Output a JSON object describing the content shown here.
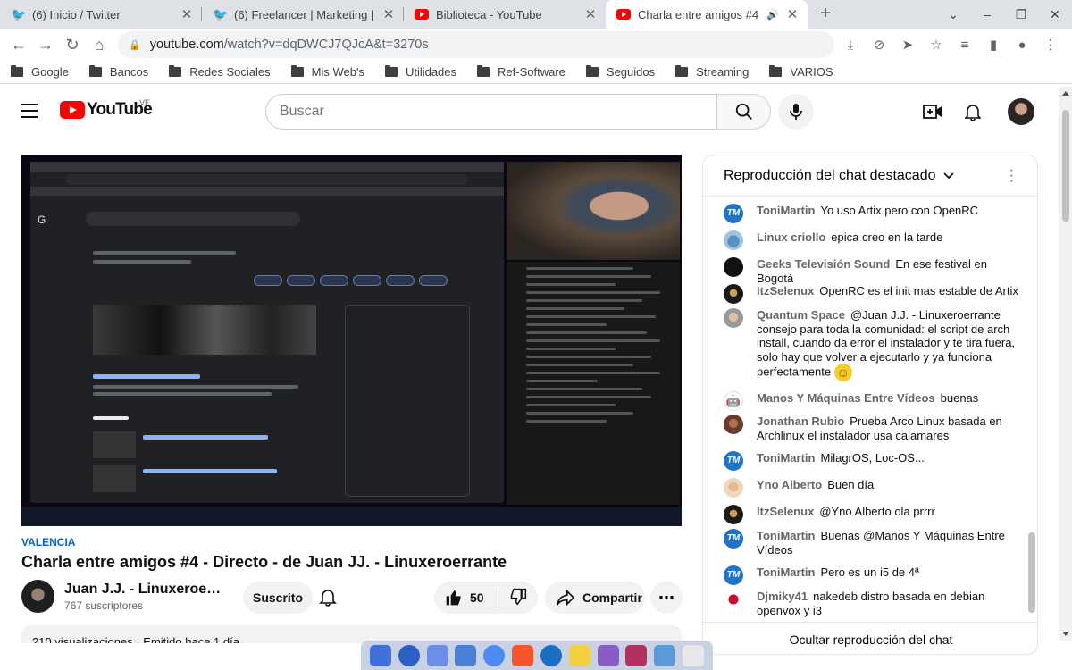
{
  "browser": {
    "tabs": [
      {
        "title": "(6) Inicio / Twitter",
        "favicon": "twitter-icon",
        "active": false
      },
      {
        "title": "(6) Freelancer | Marketing |",
        "favicon": "twitter-icon",
        "active": false
      },
      {
        "title": "Biblioteca - YouTube",
        "favicon": "youtube-icon",
        "active": false
      },
      {
        "title": "Charla entre amigos #4",
        "favicon": "youtube-icon",
        "active": true
      }
    ],
    "url_host": "youtube.com",
    "url_rest": "/watch?v=dqDWCJ7QJcA&t=3270s",
    "bookmarks": [
      "Google",
      "Bancos",
      "Redes Sociales",
      "Mis Web's",
      "Utilidades",
      "Ref-Software",
      "Seguidos",
      "Streaming",
      "VARIOS"
    ]
  },
  "youtube": {
    "logo_text": "YouTube",
    "country": "VE",
    "search_placeholder": "Buscar"
  },
  "video": {
    "location": "VALENCIA",
    "title": "Charla entre amigos #4 - Directo - de Juan JJ. - Linuxeroerrante",
    "channel_name": "Juan J.J. - Linuxeroerra...",
    "subscribers": "767 suscriptores",
    "subscribed_label": "Suscrito",
    "likes": "50",
    "share_label": "Compartir",
    "description_preview": "210 visualizaciones · Emitido hace 1 día"
  },
  "chat": {
    "header": "Reproducción del chat destacado",
    "hide_label": "Ocultar reproducción del chat",
    "messages": [
      {
        "author": "ToniMartin",
        "text": "Yo uso Artix pero con OpenRC",
        "avatar": "tm"
      },
      {
        "author": "Linux criollo",
        "text": "epica creo en la tarde",
        "avatar": "lc"
      },
      {
        "author": "Geeks Televisión Sound",
        "text": "En ese festival en Bogotá",
        "avatar": "gts"
      },
      {
        "author": "ItzSelenux",
        "text": "OpenRC es el init mas estable de Artix",
        "avatar": "itz"
      },
      {
        "author": "Quantum Space",
        "text": "@Juan J.J. - Linuxeroerrante consejo para toda la comunidad: el script de arch install, cuando da error el instalador y te tira fuera, solo hay que volver a ejecutarlo y ya funciona perfectamente",
        "avatar": "qs",
        "emoji": "🙂"
      },
      {
        "author": "Manos Y Máquinas Entre Vídeos",
        "text": "buenas",
        "avatar": "mym"
      },
      {
        "author": "Jonathan Rubio",
        "text": "Prueba Arco Linux basada en Archlinux el instalador usa calamares",
        "avatar": "jr"
      },
      {
        "author": "ToniMartin",
        "text": "MilagrOS, Loc-OS...",
        "avatar": "tm"
      },
      {
        "author": "Yno Alberto",
        "text": "Buen día",
        "avatar": "ya"
      },
      {
        "author": "ItzSelenux",
        "text": "@Yno Alberto ola prrrr",
        "avatar": "itz"
      },
      {
        "author": "ToniMartin",
        "text": "Buenas @Manos Y Máquinas Entre Vídeos",
        "avatar": "tm"
      },
      {
        "author": "ToniMartin",
        "text": "Pero es un i5 de 4ª",
        "avatar": "tm"
      },
      {
        "author": "Djmiky41",
        "text": "nakedeb distro basada en debian openvox y i3",
        "avatar": "dj"
      }
    ]
  },
  "colors": {
    "yt_red": "#ff0000",
    "link_blue": "#065fd4",
    "chrome_tabbar": "#dee1e6"
  }
}
